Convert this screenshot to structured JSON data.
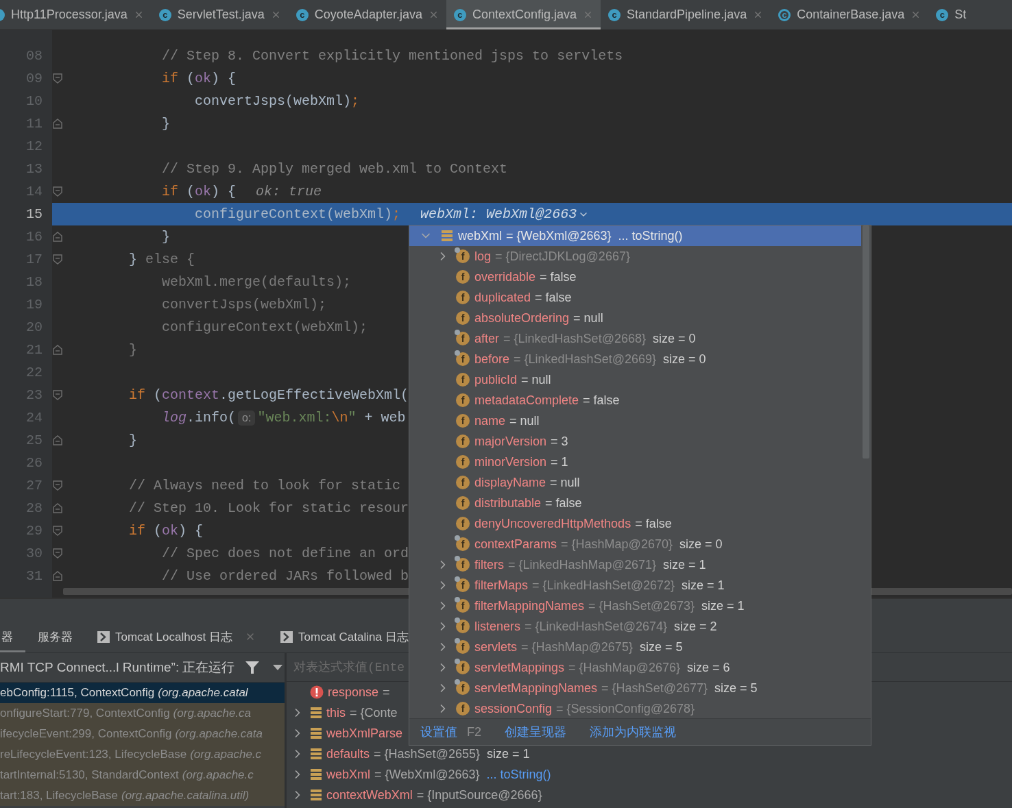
{
  "editor_tabs": [
    {
      "label": "Http11Processor.java",
      "kind": "class",
      "selected": false,
      "closable": true
    },
    {
      "label": "ServletTest.java",
      "icon_letter": "c",
      "kind": "class",
      "selected": false,
      "closable": true
    },
    {
      "label": "CoyoteAdapter.java",
      "icon_letter": "c",
      "kind": "class",
      "selected": false,
      "closable": true
    },
    {
      "label": "ContextConfig.java",
      "icon_letter": "c",
      "kind": "class",
      "selected": true,
      "closable": true
    },
    {
      "label": "StandardPipeline.java",
      "icon_letter": "c",
      "kind": "class",
      "selected": false,
      "closable": true
    },
    {
      "label": "ContainerBase.java",
      "icon_letter": "c",
      "kind": "abstract",
      "selected": false,
      "closable": true
    },
    {
      "label": "St",
      "icon_letter": "c",
      "kind": "class",
      "selected": false,
      "closable": false
    }
  ],
  "code_lines": [
    {
      "number": "08",
      "kind": "plain",
      "current": false,
      "tokens": [
        {
          "kind": "comment",
          "text": "            // Step 8. Convert explicitly mentioned jsps to servlets"
        }
      ]
    },
    {
      "number": "09",
      "kind": "fold_start",
      "current": false,
      "tokens": [
        {
          "kind": "kw",
          "text": "            if"
        },
        {
          "kind": "plain",
          "text": " ("
        },
        {
          "kind": "field",
          "text": "ok"
        },
        {
          "kind": "plain",
          "text": ") {"
        }
      ]
    },
    {
      "number": "10",
      "kind": "plain",
      "current": false,
      "tokens": [
        {
          "kind": "plain",
          "text": "                convertJsps(webXml)"
        },
        {
          "kind": "punct",
          "text": ";"
        }
      ]
    },
    {
      "number": "11",
      "kind": "fold_end",
      "current": false,
      "tokens": [
        {
          "kind": "plain",
          "text": "            }"
        }
      ]
    },
    {
      "number": "12",
      "kind": "plain",
      "current": false
    },
    {
      "number": "13",
      "kind": "plain",
      "current": false,
      "tokens": [
        {
          "kind": "comment",
          "text": "            // Step 9. Apply merged web.xml to Context"
        }
      ]
    },
    {
      "number": "14",
      "kind": "fold_start",
      "current": false,
      "tokens": [
        {
          "kind": "kw",
          "text": "            if"
        },
        {
          "kind": "plain",
          "text": " ("
        },
        {
          "kind": "field",
          "text": "ok"
        },
        {
          "kind": "plain",
          "text": ") {"
        },
        {
          "kind": "value_hint",
          "text": "ok: true"
        }
      ]
    },
    {
      "number": "15",
      "kind": "plain",
      "current": true,
      "tokens": [
        {
          "kind": "plain",
          "text": "                configureContext(webXml)"
        },
        {
          "kind": "punct",
          "text": ";"
        },
        {
          "kind": "debug_value",
          "text": "webXml: WebXml@2663"
        }
      ]
    },
    {
      "number": "16",
      "kind": "fold_end",
      "current": false,
      "tokens": [
        {
          "kind": "plain",
          "text": "            }"
        }
      ]
    },
    {
      "number": "17",
      "kind": "fold_start",
      "current": false,
      "tokens": [
        {
          "kind": "plain",
          "text": "        } "
        },
        {
          "kind": "dim",
          "text": "else {"
        }
      ]
    },
    {
      "number": "18",
      "kind": "plain",
      "current": false,
      "tokens": [
        {
          "kind": "dim",
          "text": "            webXml.merge(defaults);"
        }
      ]
    },
    {
      "number": "19",
      "kind": "plain",
      "current": false,
      "tokens": [
        {
          "kind": "dim",
          "text": "            convertJsps(webXml);"
        }
      ]
    },
    {
      "number": "20",
      "kind": "plain",
      "current": false,
      "tokens": [
        {
          "kind": "dim",
          "text": "            configureContext(webXml);"
        }
      ]
    },
    {
      "number": "21",
      "kind": "fold_end",
      "current": false,
      "tokens": [
        {
          "kind": "dim",
          "text": "        }"
        }
      ]
    },
    {
      "number": "22",
      "kind": "plain",
      "current": false
    },
    {
      "number": "23",
      "kind": "fold_start",
      "current": false,
      "tokens": [
        {
          "kind": "kw",
          "text": "        if"
        },
        {
          "kind": "plain",
          "text": " ("
        },
        {
          "kind": "field",
          "text": "context"
        },
        {
          "kind": "plain",
          "text": ".getLogEffectiveWebXml("
        }
      ]
    },
    {
      "number": "24",
      "kind": "plain",
      "current": false,
      "tokens": [
        {
          "kind": "field_italic",
          "text": "            log"
        },
        {
          "kind": "plain",
          "text": ".info("
        },
        {
          "kind": "param_hint",
          "text": "o:"
        },
        {
          "kind": "string",
          "text": "\"web.xml:"
        },
        {
          "kind": "escape",
          "text": "\\n"
        },
        {
          "kind": "string",
          "text": "\""
        },
        {
          "kind": "plain",
          "text": " + web"
        }
      ]
    },
    {
      "number": "25",
      "kind": "fold_end",
      "current": false,
      "tokens": [
        {
          "kind": "plain",
          "text": "        }"
        }
      ]
    },
    {
      "number": "26",
      "kind": "plain",
      "current": false
    },
    {
      "number": "27",
      "kind": "fold_start",
      "current": false,
      "tokens": [
        {
          "kind": "comment",
          "text": "        // Always need to look for static"
        }
      ]
    },
    {
      "number": "28",
      "kind": "fold_end",
      "current": false,
      "tokens": [
        {
          "kind": "comment",
          "text": "        // Step 10. Look for static resour"
        }
      ]
    },
    {
      "number": "29",
      "kind": "fold_start",
      "current": false,
      "tokens": [
        {
          "kind": "kw",
          "text": "        if"
        },
        {
          "kind": "plain",
          "text": " ("
        },
        {
          "kind": "field",
          "text": "ok"
        },
        {
          "kind": "plain",
          "text": ") {"
        }
      ]
    },
    {
      "number": "30",
      "kind": "fold_start",
      "current": false,
      "tokens": [
        {
          "kind": "comment",
          "text": "            // Spec does not define an ord"
        }
      ]
    },
    {
      "number": "31",
      "kind": "fold_end",
      "current": false,
      "tokens": [
        {
          "kind": "comment",
          "text": "            // Use ordered JARs followed b"
        }
      ]
    }
  ],
  "debug_popup": {
    "root": {
      "name": "webXml",
      "value": "= {WebXml@2663}",
      "extra": "... toString()",
      "expanded": true,
      "selected": true
    },
    "fields": [
      {
        "name": "log",
        "value": "= {DirectJDKLog@2667}",
        "kind": "ref",
        "expandable": true,
        "overlay": true,
        "icon_letter": "f"
      },
      {
        "name": "overridable",
        "value": "= false",
        "kind": "literal",
        "expandable": false,
        "overlay": false,
        "icon_letter": "f"
      },
      {
        "name": "duplicated",
        "value": "= false",
        "kind": "literal",
        "expandable": false,
        "overlay": false,
        "icon_letter": "f"
      },
      {
        "name": "absoluteOrdering",
        "value": "= null",
        "kind": "literal",
        "expandable": false,
        "overlay": false,
        "icon_letter": "f"
      },
      {
        "name": "after",
        "value": "= {LinkedHashSet@2668}",
        "kind": "ref",
        "extra": "size = 0",
        "expandable": false,
        "overlay": true,
        "icon_letter": "f"
      },
      {
        "name": "before",
        "value": "= {LinkedHashSet@2669}",
        "kind": "ref",
        "extra": "size = 0",
        "expandable": false,
        "overlay": true,
        "icon_letter": "f"
      },
      {
        "name": "publicId",
        "value": "= null",
        "kind": "literal",
        "expandable": false,
        "overlay": false,
        "icon_letter": "f"
      },
      {
        "name": "metadataComplete",
        "value": "= false",
        "kind": "literal",
        "expandable": false,
        "overlay": false,
        "icon_letter": "f"
      },
      {
        "name": "name",
        "value": "= null",
        "kind": "literal",
        "expandable": false,
        "overlay": false,
        "icon_letter": "f"
      },
      {
        "name": "majorVersion",
        "value": "= 3",
        "kind": "literal",
        "expandable": false,
        "overlay": false,
        "icon_letter": "f"
      },
      {
        "name": "minorVersion",
        "value": "= 1",
        "kind": "literal",
        "expandable": false,
        "overlay": false,
        "icon_letter": "f"
      },
      {
        "name": "displayName",
        "value": "= null",
        "kind": "literal",
        "expandable": false,
        "overlay": false,
        "icon_letter": "f"
      },
      {
        "name": "distributable",
        "value": "= false",
        "kind": "literal",
        "expandable": false,
        "overlay": false,
        "icon_letter": "f"
      },
      {
        "name": "denyUncoveredHttpMethods",
        "value": "= false",
        "kind": "literal",
        "expandable": false,
        "overlay": false,
        "icon_letter": "f"
      },
      {
        "name": "contextParams",
        "value": "= {HashMap@2670}",
        "kind": "ref",
        "extra": "size = 0",
        "expandable": false,
        "overlay": true,
        "icon_letter": "f"
      },
      {
        "name": "filters",
        "value": "= {LinkedHashMap@2671}",
        "kind": "ref",
        "extra": "size = 1",
        "expandable": true,
        "overlay": true,
        "icon_letter": "f"
      },
      {
        "name": "filterMaps",
        "value": "= {LinkedHashSet@2672}",
        "kind": "ref",
        "extra": "size = 1",
        "expandable": true,
        "overlay": true,
        "icon_letter": "f"
      },
      {
        "name": "filterMappingNames",
        "value": "= {HashSet@2673}",
        "kind": "ref",
        "extra": "size = 1",
        "expandable": true,
        "overlay": true,
        "icon_letter": "f"
      },
      {
        "name": "listeners",
        "value": "= {LinkedHashSet@2674}",
        "kind": "ref",
        "extra": "size = 2",
        "expandable": true,
        "overlay": true,
        "icon_letter": "f"
      },
      {
        "name": "servlets",
        "value": "= {HashMap@2675}",
        "kind": "ref",
        "extra": "size = 5",
        "expandable": true,
        "overlay": true,
        "icon_letter": "f"
      },
      {
        "name": "servletMappings",
        "value": "= {HashMap@2676}",
        "kind": "ref",
        "extra": "size = 6",
        "expandable": true,
        "overlay": true,
        "icon_letter": "f"
      },
      {
        "name": "servletMappingNames",
        "value": "= {HashSet@2677}",
        "kind": "ref",
        "extra": "size = 5",
        "expandable": true,
        "overlay": true,
        "icon_letter": "f"
      },
      {
        "name": "sessionConfig",
        "value": "= {SessionConfig@2678}",
        "kind": "ref",
        "expandable": true,
        "overlay": false,
        "icon_letter": "f"
      }
    ],
    "actions": [
      {
        "label": "设置值",
        "shortcut": "F2"
      },
      {
        "label": "创建呈现器"
      },
      {
        "label": "添加为内联监视"
      }
    ]
  },
  "tool_tabs": [
    {
      "label": "器",
      "kind": "plain",
      "closable": false,
      "selected": true
    },
    {
      "label": "服务器",
      "kind": "plain",
      "closable": false,
      "selected": false
    },
    {
      "label": "Tomcat Localhost 日志",
      "kind": "console",
      "closable": true,
      "selected": false
    },
    {
      "label": "Tomcat Catalina 日志",
      "kind": "console",
      "closable": false,
      "selected": false
    }
  ],
  "debugger": {
    "thread": "RMI TCP Connect...l Runtime”: 正在运行",
    "frames": [
      {
        "location": "ebConfig:1115, ContextConfig",
        "package": "(org.apache.catal",
        "selected": true,
        "library": false
      },
      {
        "location": "onfigureStart:779, ContextConfig",
        "package": "(org.apache.ca",
        "selected": false,
        "library": true
      },
      {
        "location": "ifecycleEvent:299, ContextConfig",
        "package": "(org.apache.cata",
        "selected": false,
        "library": true
      },
      {
        "location": "reLifecycleEvent:123, LifecycleBase",
        "package": "(org.apache.c",
        "selected": false,
        "library": true
      },
      {
        "location": "tartInternal:5130, StandardContext",
        "package": "(org.apache.c",
        "selected": false,
        "library": true
      },
      {
        "location": "tart:183, LifecycleBase",
        "package": "(org.apache.catalina.util)",
        "selected": false,
        "library": true
      }
    ],
    "evaluate_placeholder": "对表达式求值(Ente",
    "variables": [
      {
        "kind": "error",
        "name": "response",
        "value": "=",
        "expandable": false
      },
      {
        "kind": "object",
        "name": "this",
        "value": "= {Conte",
        "expandable": true
      },
      {
        "kind": "object",
        "name": "webXmlParse",
        "expandable": true
      },
      {
        "kind": "object",
        "name": "defaults",
        "value": "= {HashSet@2655}",
        "extra": "size = 1",
        "extra_link": false,
        "expandable": true
      },
      {
        "kind": "object",
        "name": "webXml",
        "value": "= {WebXml@2663}",
        "extra": "... toString()",
        "extra_link": true,
        "expandable": true
      },
      {
        "kind": "object",
        "name": "contextWebXml",
        "value": "= {InputSource@2666}",
        "expandable": true
      }
    ]
  }
}
